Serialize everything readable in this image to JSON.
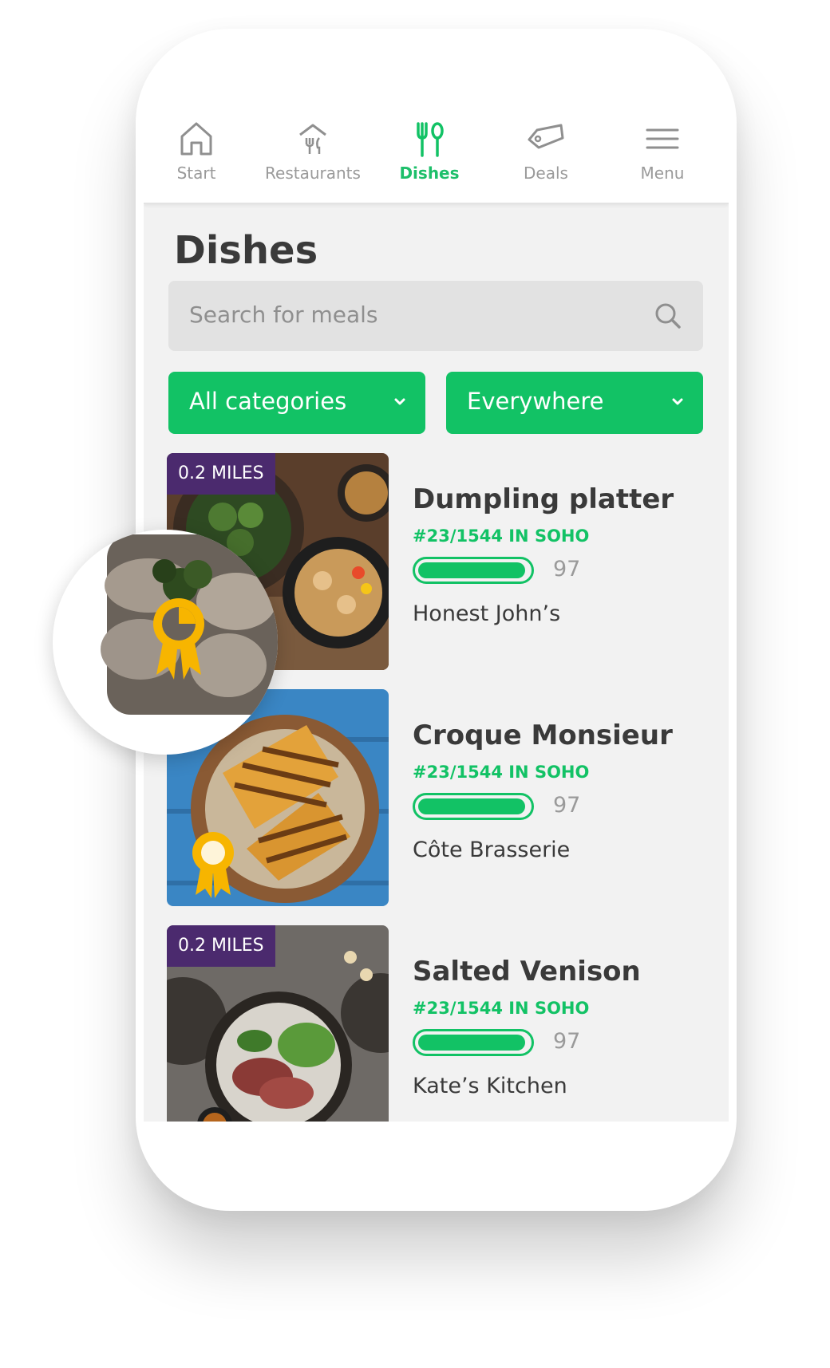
{
  "nav": {
    "items": [
      {
        "label": "Start",
        "icon": "home-icon"
      },
      {
        "label": "Restaurants",
        "icon": "restaurant-icon"
      },
      {
        "label": "Dishes",
        "icon": "cutlery-icon"
      },
      {
        "label": "Deals",
        "icon": "tag-icon"
      },
      {
        "label": "Menu",
        "icon": "hamburger-icon"
      }
    ],
    "active": "Dishes"
  },
  "page": {
    "title": "Dishes"
  },
  "search": {
    "placeholder": "Search for meals"
  },
  "filters": {
    "category": "All categories",
    "location": "Everywhere"
  },
  "colors": {
    "accent": "#12c265",
    "badge": "#4b2a6e",
    "award": "#f7b500"
  },
  "dishes": [
    {
      "name": "Dumpling platter",
      "rank": "#23/1544 IN SOHO",
      "score": "97",
      "restaurant": "Honest John’s",
      "distance": "0.2 MILES"
    },
    {
      "name": "Croque Monsieur",
      "rank": "#23/1544 IN SOHO",
      "score": "97",
      "restaurant": "Côte Brasserie",
      "distance": ""
    },
    {
      "name": "Salted Venison",
      "rank": "#23/1544 IN SOHO",
      "score": "97",
      "restaurant": "Kate’s Kitchen",
      "distance": "0.2 MILES"
    }
  ]
}
